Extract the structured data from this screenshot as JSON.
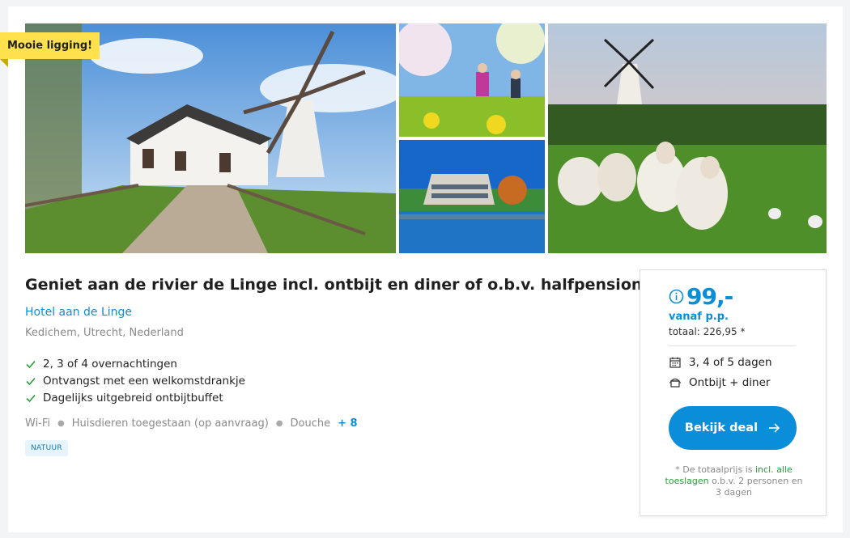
{
  "badge": {
    "label": "Mooie ligging!"
  },
  "deal": {
    "title": "Geniet aan de rivier de Linge incl. ontbijt en diner of o.b.v. halfpension",
    "hotel_name": "Hotel aan de Linge",
    "location": "Kedichem, Utrecht, Nederland",
    "features": [
      "2, 3 of 4 overnachtingen",
      "Ontvangst met een welkomstdrankje",
      "Dagelijks uitgebreid ontbijtbuffet"
    ],
    "amenities": [
      "Wi-Fi",
      "Huisdieren toegestaan (op aanvraag)",
      "Douche"
    ],
    "amenities_more": "+ 8",
    "tag": "NATUUR"
  },
  "pricing": {
    "price": "99,-",
    "per_person": "vanaf p.p.",
    "total": "totaal: 226,95 *",
    "days": "3, 4 of 5 dagen",
    "board": "Ontbijt + diner",
    "button_label": "Bekijk deal",
    "note_prefix": "* De totaalprijs is ",
    "note_highlight": "incl. alle toeslagen",
    "note_suffix": " o.b.v. 2 personen en 3 dagen"
  },
  "colors": {
    "accent": "#0a8ed9",
    "badge": "#ffe14d",
    "check": "#2a9d3a",
    "tag_bg": "#e6f4fc"
  },
  "icons": {
    "feature": "check-icon",
    "price_info": "info-icon",
    "days": "calendar-icon",
    "board": "cooking-pot-icon",
    "button": "arrow-right-icon"
  }
}
